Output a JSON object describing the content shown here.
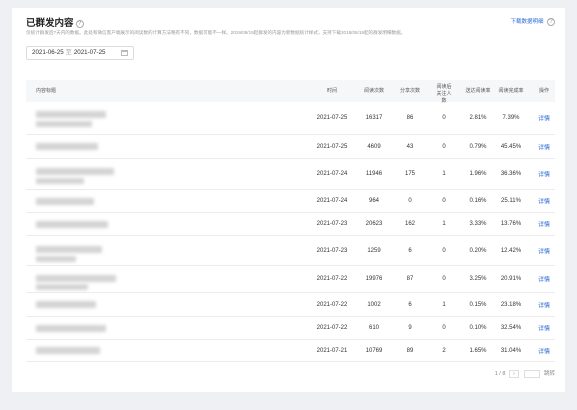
{
  "header": {
    "title": "已群发内容",
    "download_label": "下载数据明细",
    "description": "仅统计群发后7天内的数据。此处和微信客户端展示的阅读数的计算方法略有不同，数据可能不一样。2019/08/19起群发的内容为新数据统计样式，支持下载2018/08/19起的群发明细数据。",
    "date_start": "2021-06-25",
    "date_sep": "至",
    "date_end": "2021-07-25"
  },
  "table": {
    "columns": {
      "content_title": "内容标题",
      "time": "时间",
      "reads": "阅读次数",
      "shares": "分享次数",
      "followers": "阅读后关注人数",
      "delivery_rate": "送达阅读率",
      "completion_rate": "阅读完成率",
      "action": "操作"
    },
    "rows": [
      {
        "time": "2021-07-25",
        "reads": "16317",
        "shares": "86",
        "followers": "0",
        "delivery_rate": "2.81%",
        "completion_rate": "7.39%",
        "action": "详情"
      },
      {
        "time": "2021-07-25",
        "reads": "4609",
        "shares": "43",
        "followers": "0",
        "delivery_rate": "0.79%",
        "completion_rate": "45.45%",
        "action": "详情"
      },
      {
        "time": "2021-07-24",
        "reads": "11946",
        "shares": "175",
        "followers": "1",
        "delivery_rate": "1.96%",
        "completion_rate": "36.36%",
        "action": "详情"
      },
      {
        "time": "2021-07-24",
        "reads": "964",
        "shares": "0",
        "followers": "0",
        "delivery_rate": "0.16%",
        "completion_rate": "25.11%",
        "action": "详情"
      },
      {
        "time": "2021-07-23",
        "reads": "20623",
        "shares": "162",
        "followers": "1",
        "delivery_rate": "3.33%",
        "completion_rate": "13.76%",
        "action": "详情"
      },
      {
        "time": "2021-07-23",
        "reads": "1259",
        "shares": "6",
        "followers": "0",
        "delivery_rate": "0.20%",
        "completion_rate": "12.42%",
        "action": "详情"
      },
      {
        "time": "2021-07-22",
        "reads": "19976",
        "shares": "87",
        "followers": "0",
        "delivery_rate": "3.25%",
        "completion_rate": "20.91%",
        "action": "详情"
      },
      {
        "time": "2021-07-22",
        "reads": "1002",
        "shares": "6",
        "followers": "1",
        "delivery_rate": "0.15%",
        "completion_rate": "23.18%",
        "action": "详情"
      },
      {
        "time": "2021-07-22",
        "reads": "610",
        "shares": "9",
        "followers": "0",
        "delivery_rate": "0.10%",
        "completion_rate": "32.54%",
        "action": "详情"
      },
      {
        "time": "2021-07-21",
        "reads": "10769",
        "shares": "89",
        "followers": "2",
        "delivery_rate": "1.65%",
        "completion_rate": "31.04%",
        "action": "详情"
      }
    ]
  },
  "pagination": {
    "page": "1 / 8",
    "next": "›",
    "jump_label": "跳转"
  }
}
